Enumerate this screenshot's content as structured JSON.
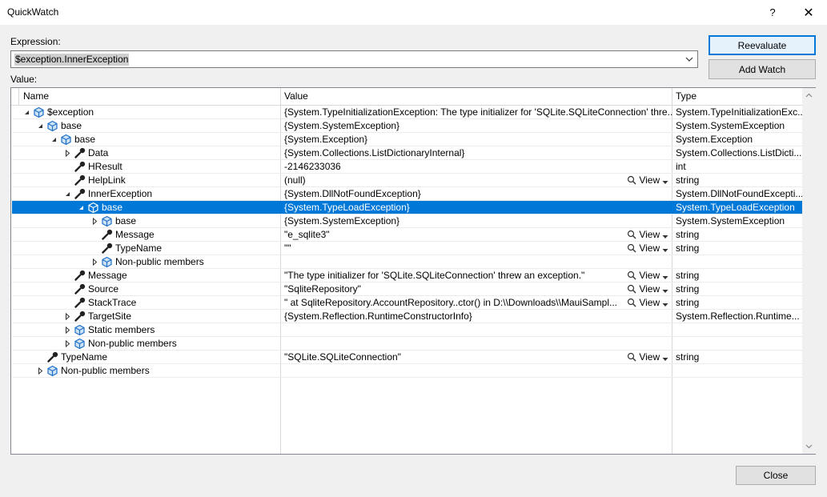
{
  "window": {
    "title": "QuickWatch",
    "help_label": "?",
    "close_glyph": "✕"
  },
  "expression": {
    "label": "Expression:",
    "value": "$exception.InnerException"
  },
  "value_label": "Value:",
  "buttons": {
    "reevaluate": "Reevaluate",
    "add_watch": "Add Watch",
    "close": "Close"
  },
  "columns": [
    "Name",
    "Value",
    "Type"
  ],
  "view_label": "View",
  "rows": [
    {
      "name": "$exception",
      "value": "{System.TypeInitializationException: The type initializer for 'SQLite.SQLiteConnection' thre...",
      "type": "System.TypeInitializationExc...",
      "level": 0,
      "exp": "open",
      "icon": "object",
      "view": false
    },
    {
      "name": "base",
      "value": "{System.SystemException}",
      "type": "System.SystemException",
      "level": 1,
      "exp": "open",
      "icon": "object",
      "view": false
    },
    {
      "name": "base",
      "value": "{System.Exception}",
      "type": "System.Exception",
      "level": 2,
      "exp": "open",
      "icon": "object",
      "view": false
    },
    {
      "name": "Data",
      "value": "{System.Collections.ListDictionaryInternal}",
      "type": "System.Collections.ListDicti...",
      "level": 3,
      "exp": "closed",
      "icon": "wrench",
      "view": false
    },
    {
      "name": "HResult",
      "value": "-2146233036",
      "type": "int",
      "level": 3,
      "exp": "none",
      "icon": "wrench",
      "view": false
    },
    {
      "name": "HelpLink",
      "value": "(null)",
      "type": "string",
      "level": 3,
      "exp": "none",
      "icon": "wrench",
      "view": true
    },
    {
      "name": "InnerException",
      "value": "{System.DllNotFoundException}",
      "type": "System.DllNotFoundExcepti...",
      "level": 3,
      "exp": "open",
      "icon": "wrench",
      "view": false
    },
    {
      "name": "base",
      "value": "{System.TypeLoadException}",
      "type": "System.TypeLoadException",
      "level": 4,
      "exp": "open",
      "icon": "object",
      "view": false,
      "selected": true
    },
    {
      "name": "base",
      "value": "{System.SystemException}",
      "type": "System.SystemException",
      "level": 5,
      "exp": "closed",
      "icon": "object",
      "view": false
    },
    {
      "name": "Message",
      "value": "\"e_sqlite3\"",
      "type": "string",
      "level": 5,
      "exp": "none",
      "icon": "wrench",
      "view": true
    },
    {
      "name": "TypeName",
      "value": "\"\"",
      "type": "string",
      "level": 5,
      "exp": "none",
      "icon": "wrench",
      "view": true
    },
    {
      "name": "Non-public members",
      "value": "",
      "type": "",
      "level": 5,
      "exp": "closed",
      "icon": "object",
      "view": false
    },
    {
      "name": "Message",
      "value": "\"The type initializer for 'SQLite.SQLiteConnection' threw an exception.\"",
      "type": "string",
      "level": 3,
      "exp": "none",
      "icon": "wrench",
      "view": true
    },
    {
      "name": "Source",
      "value": "\"SqliteRepository\"",
      "type": "string",
      "level": 3,
      "exp": "none",
      "icon": "wrench",
      "view": true
    },
    {
      "name": "StackTrace",
      "value": "\"   at SqliteRepository.AccountRepository..ctor() in D:\\\\Downloads\\\\MauiSampl...",
      "type": "string",
      "level": 3,
      "exp": "none",
      "icon": "wrench",
      "view": true
    },
    {
      "name": "TargetSite",
      "value": "{System.Reflection.RuntimeConstructorInfo}",
      "type": "System.Reflection.Runtime...",
      "level": 3,
      "exp": "closed",
      "icon": "wrench",
      "view": false
    },
    {
      "name": "Static members",
      "value": "",
      "type": "",
      "level": 3,
      "exp": "closed",
      "icon": "object",
      "view": false
    },
    {
      "name": "Non-public members",
      "value": "",
      "type": "",
      "level": 3,
      "exp": "closed",
      "icon": "object",
      "view": false
    },
    {
      "name": "TypeName",
      "value": "\"SQLite.SQLiteConnection\"",
      "type": "string",
      "level": 1,
      "exp": "none",
      "icon": "wrench",
      "view": true
    },
    {
      "name": "Non-public members",
      "value": "",
      "type": "",
      "level": 1,
      "exp": "closed",
      "icon": "object",
      "view": false
    }
  ],
  "colors": {
    "accent": "#0078d7",
    "selection": "#0078d7",
    "object_icon": "#1e6fc8"
  }
}
